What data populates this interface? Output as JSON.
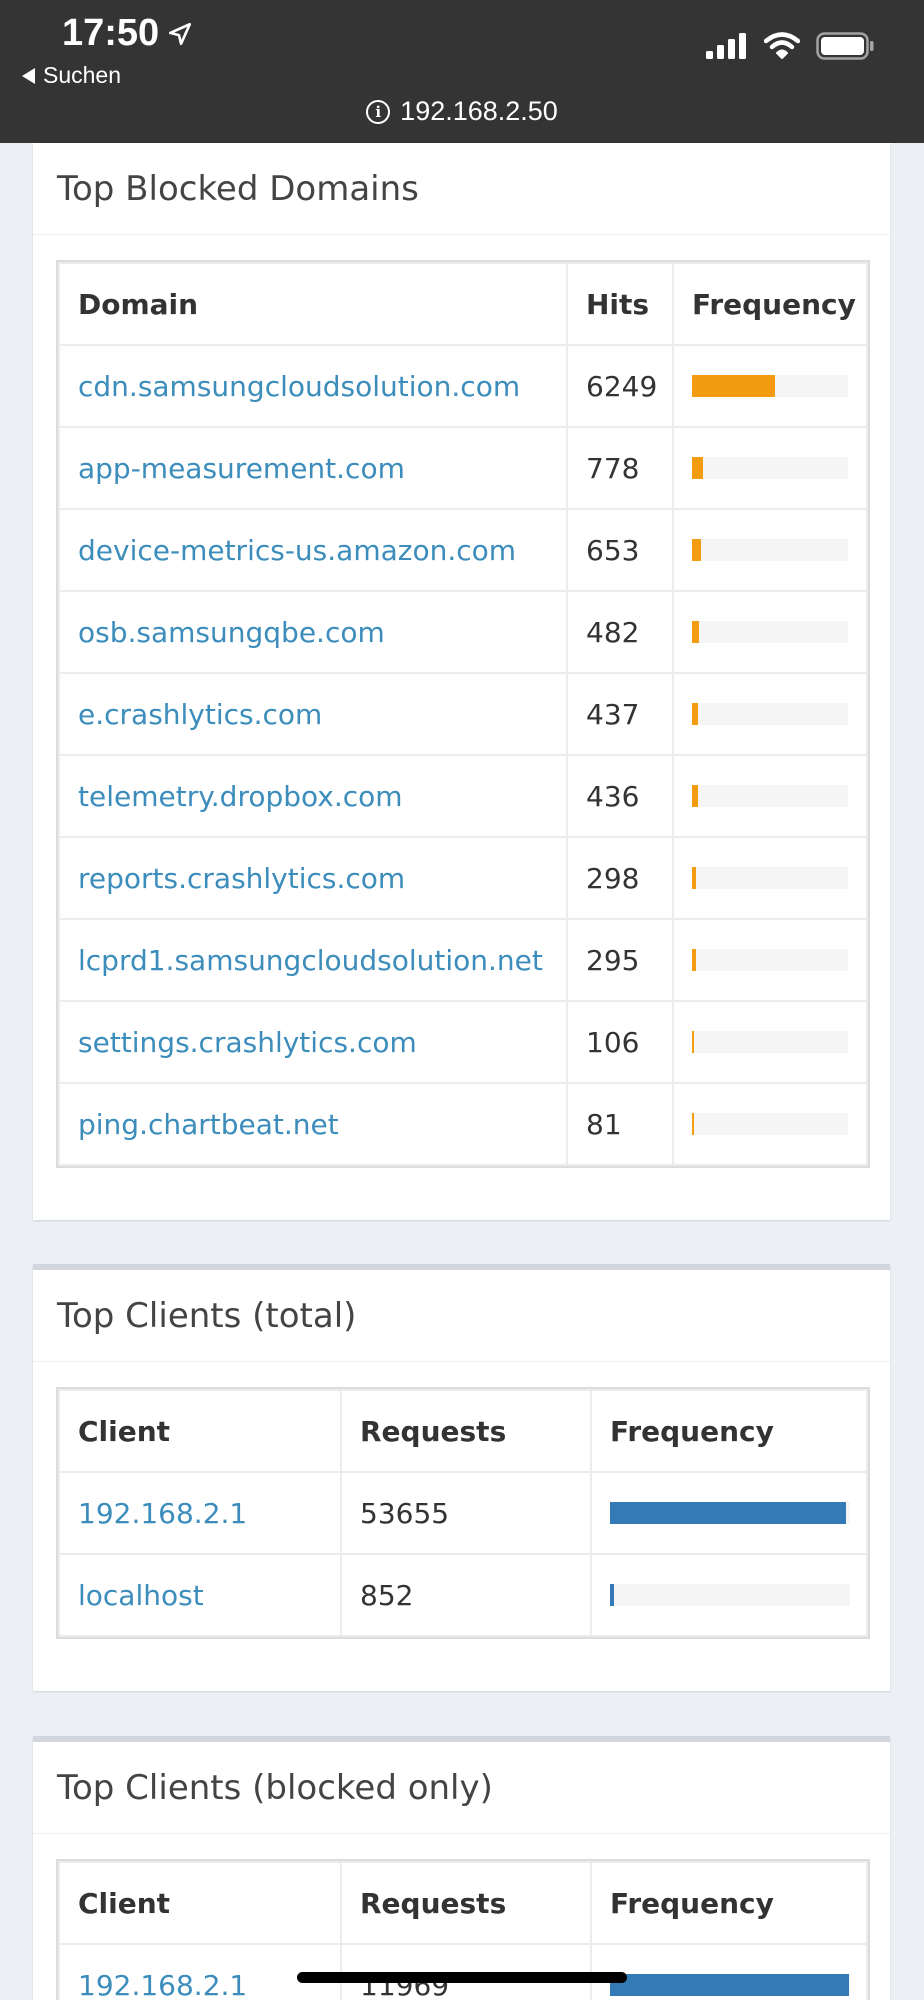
{
  "status": {
    "time": "17:50",
    "back_label": "Suchen",
    "url": "192.168.2.50"
  },
  "colors": {
    "accent": "#3c8dbc",
    "blocked": "#f39c12",
    "clients": "#337ab7"
  },
  "blocked_domains": {
    "title": "Top Blocked Domains",
    "headers": {
      "domain": "Domain",
      "hits": "Hits",
      "frequency": "Frequency"
    },
    "rows": [
      {
        "domain": "cdn.samsungcloudsolution.com",
        "hits": "6249",
        "freq": 0.53
      },
      {
        "domain": "app-measurement.com",
        "hits": "778",
        "freq": 0.07
      },
      {
        "domain": "device-metrics-us.amazon.com",
        "hits": "653",
        "freq": 0.06
      },
      {
        "domain": "osb.samsungqbe.com",
        "hits": "482",
        "freq": 0.045
      },
      {
        "domain": "e.crashlytics.com",
        "hits": "437",
        "freq": 0.04
      },
      {
        "domain": "telemetry.dropbox.com",
        "hits": "436",
        "freq": 0.04
      },
      {
        "domain": "reports.crashlytics.com",
        "hits": "298",
        "freq": 0.025
      },
      {
        "domain": "lcprd1.samsungcloudsolution.net",
        "hits": "295",
        "freq": 0.025
      },
      {
        "domain": "settings.crashlytics.com",
        "hits": "106",
        "freq": 0.012
      },
      {
        "domain": "ping.chartbeat.net",
        "hits": "81",
        "freq": 0.008
      }
    ]
  },
  "clients_total": {
    "title": "Top Clients (total)",
    "headers": {
      "client": "Client",
      "requests": "Requests",
      "frequency": "Frequency"
    },
    "rows": [
      {
        "client": "192.168.2.1",
        "requests": "53655",
        "freq": 0.985
      },
      {
        "client": "localhost",
        "requests": "852",
        "freq": 0.016
      }
    ]
  },
  "clients_blocked": {
    "title": "Top Clients (blocked only)",
    "headers": {
      "client": "Client",
      "requests": "Requests",
      "frequency": "Frequency"
    },
    "rows": [
      {
        "client": "192.168.2.1",
        "requests": "11969",
        "freq": 0.995
      }
    ]
  }
}
